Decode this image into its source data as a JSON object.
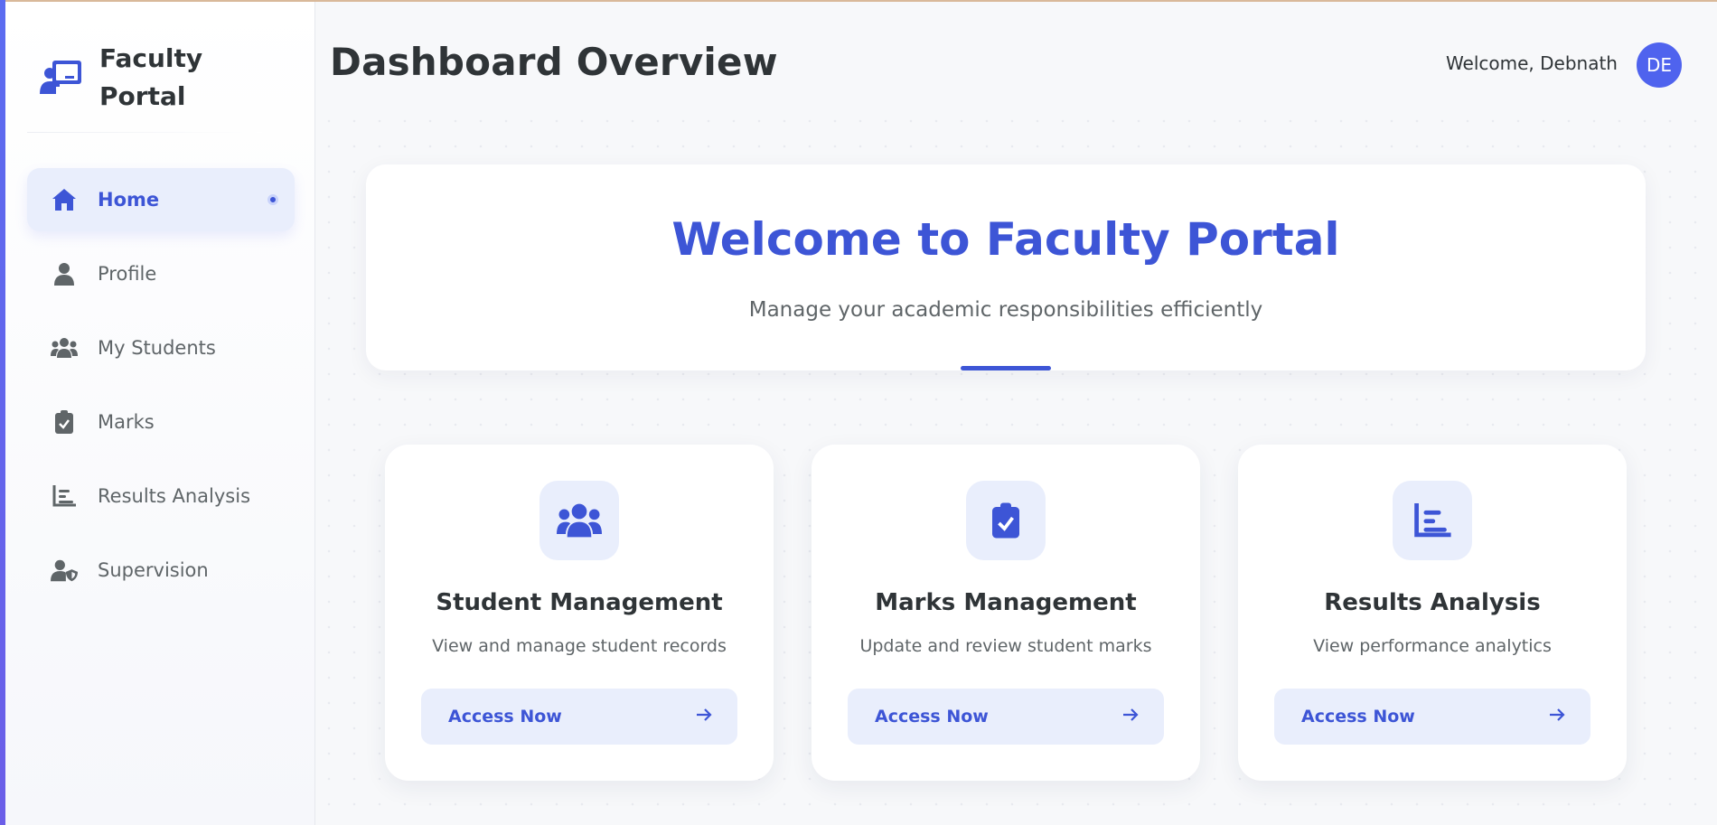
{
  "sidebar": {
    "brand_title": "Faculty Portal",
    "brand_icon": "chalkboard-teacher-icon",
    "items": [
      {
        "label": "Home",
        "icon": "home-icon",
        "active": true
      },
      {
        "label": "Profile",
        "icon": "user-icon"
      },
      {
        "label": "My Students",
        "icon": "users-icon"
      },
      {
        "label": "Marks",
        "icon": "clipboard-check-icon"
      },
      {
        "label": "Results Analysis",
        "icon": "bar-chart-icon"
      },
      {
        "label": "Supervision",
        "icon": "user-shield-icon"
      }
    ]
  },
  "header": {
    "title": "Dashboard Overview",
    "welcome": "Welcome, Debnath",
    "avatar_initials": "DE"
  },
  "hero": {
    "title": "Welcome to Faculty Portal",
    "subtitle": "Manage your academic responsibilities efficiently"
  },
  "cards": [
    {
      "title": "Student Management",
      "description": "View and manage student records",
      "button": "Access Now",
      "icon": "users-icon"
    },
    {
      "title": "Marks Management",
      "description": "Update and review student marks",
      "button": "Access Now",
      "icon": "clipboard-check-icon"
    },
    {
      "title": "Results Analysis",
      "description": "View performance analytics",
      "button": "Access Now",
      "icon": "bar-chart-icon"
    }
  ],
  "colors": {
    "accent": "#3d55d6",
    "accent_light": "#e9eefc",
    "avatar": "#4f63ee"
  }
}
